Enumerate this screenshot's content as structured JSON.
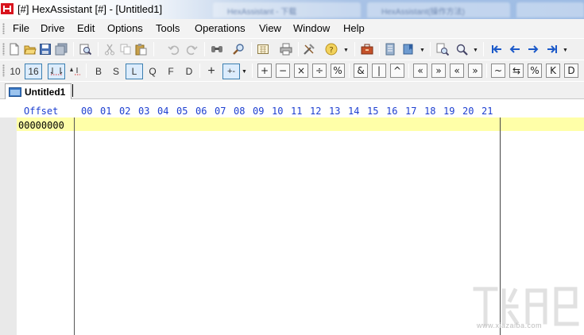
{
  "window": {
    "title": "[#] HexAssistant [#] - [Untitled1]",
    "background_tabs": [
      "HexAssistant - 下载",
      "HexAssistant(操作方法)"
    ],
    "brand_color": "#d9141e"
  },
  "menu": {
    "items": [
      "File",
      "Drive",
      "Edit",
      "Options",
      "Tools",
      "Operations",
      "View",
      "Window",
      "Help"
    ]
  },
  "toolbar1": {
    "icons": [
      "new-file-icon",
      "open-file-icon",
      "save-icon",
      "save-all-icon",
      "print-preview-icon",
      "cut-icon",
      "copy-icon",
      "paste-icon",
      "undo-icon",
      "redo-icon",
      "find-icon",
      "find-replace-icon",
      "calculator-icon",
      "print-icon",
      "tools-icon",
      "help-icon",
      "toolbox-icon",
      "notebook-icon",
      "bookmark-icon",
      "search-prev-icon",
      "search-next-icon",
      "nav-first-icon",
      "nav-prev-icon",
      "nav-next-icon",
      "nav-last-icon"
    ]
  },
  "toolbar2": {
    "base_10": "10",
    "base_16": "16",
    "data_sizes": [
      "B",
      "S",
      "L",
      "Q",
      "F",
      "D"
    ],
    "active_size": "L",
    "operators": [
      "+",
      "+-",
      "+",
      "−",
      "×",
      "÷",
      "%",
      "&",
      "|",
      "^",
      "«",
      "»",
      "«",
      "»",
      "~",
      "⇆",
      "%",
      "K",
      "D"
    ]
  },
  "tabs": {
    "active": "Untitled1"
  },
  "editor": {
    "offset_label": "Offset",
    "columns": [
      "00",
      "01",
      "02",
      "03",
      "04",
      "05",
      "06",
      "07",
      "08",
      "09",
      "10",
      "11",
      "12",
      "13",
      "14",
      "15",
      "16",
      "17",
      "18",
      "19",
      "20",
      "21"
    ],
    "rows": [
      {
        "offset": "00000000"
      }
    ],
    "header_color": "#1d3fd0",
    "current_row_color": "#ffffa8"
  },
  "watermark": {
    "url": "www.xiazaiba.com"
  }
}
